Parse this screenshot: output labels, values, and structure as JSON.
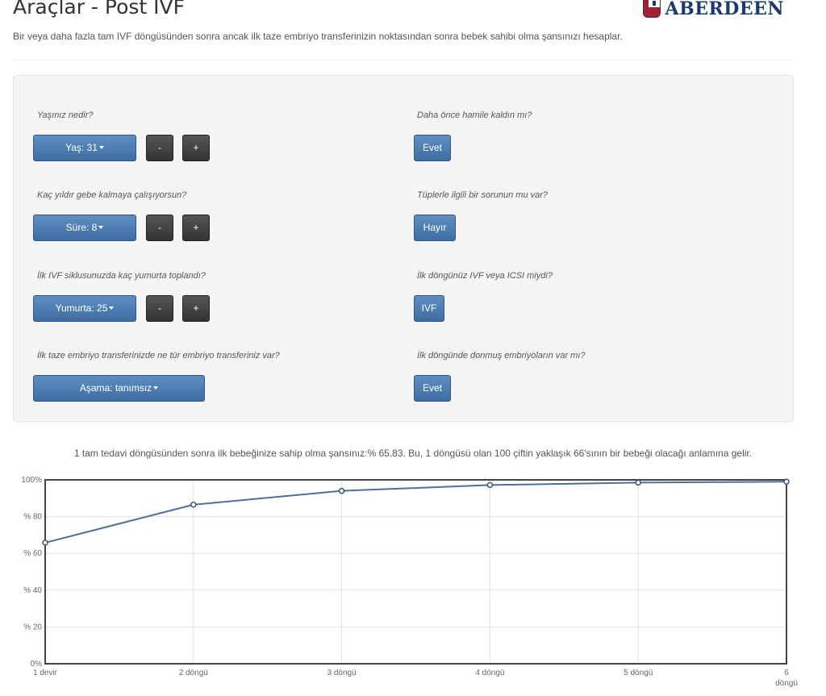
{
  "header": {
    "title": "Araçlar - Post IVF",
    "subtitle": "Bir veya daha fazla tam IVF döngüsünden sonra ancak ilk taze embriyo transferinizin noktasından sonra bebek sahibi olma şansınızı hesaplar.",
    "logo_text": "ABERDEEN"
  },
  "form": {
    "age": {
      "question": "Yaşınız nedir?",
      "value": "Yaş: 31",
      "minus": "-",
      "plus": "+"
    },
    "duration": {
      "question": "Kaç yıldır gebe kalmaya çalışıyorsun?",
      "value": "Süre: 8",
      "minus": "-",
      "plus": "+"
    },
    "eggs": {
      "question": "İlk IVF siklusunuzda kaç yumurta toplandı?",
      "value": "Yumurta: 25",
      "minus": "-",
      "plus": "+"
    },
    "stage": {
      "question": "İlk taze embriyo transferinizde ne tür embriyo transferiniz var?",
      "value": "Aşama: tanımsız"
    },
    "pregnant_before": {
      "question": "Daha önce hamile kaldın mı?",
      "value": "Evet"
    },
    "tubal": {
      "question": "Tüplerle ilgili bir sorunun mu var?",
      "value": "Hayır"
    },
    "ivf_icsi": {
      "question": "İlk döngünüz IVF veya ICSI miydi?",
      "value": "IVF"
    },
    "frozen": {
      "question": "İlk döngünde donmuş embriyoların var mı?",
      "value": "Evet"
    }
  },
  "result": {
    "text": "1 tam tedavi döngüsünden sonra ilk bebeğinize sahip olma şansınız:% 65.83. Bu, 1 döngüsü olan 100 çiftin yaklaşık 66'sının bir bebeği olacağı anlamına gelir."
  },
  "colors": {
    "button_blue": "#4a79b0",
    "button_dark": "#444444",
    "line": "#4d6f99"
  },
  "chart_data": {
    "type": "line",
    "x": [
      "1 devir",
      "2 döngü",
      "3 döngü",
      "4 döngü",
      "5 döngü",
      "6 döngü"
    ],
    "y_ticks": [
      "0%",
      "% 20",
      "% 40",
      "% 60",
      "% 80",
      "100%"
    ],
    "ylim": [
      0,
      100
    ],
    "grid": true,
    "series": [
      {
        "values": [
          65.83,
          86.5,
          94,
          97.2,
          98.5,
          99
        ]
      }
    ]
  }
}
